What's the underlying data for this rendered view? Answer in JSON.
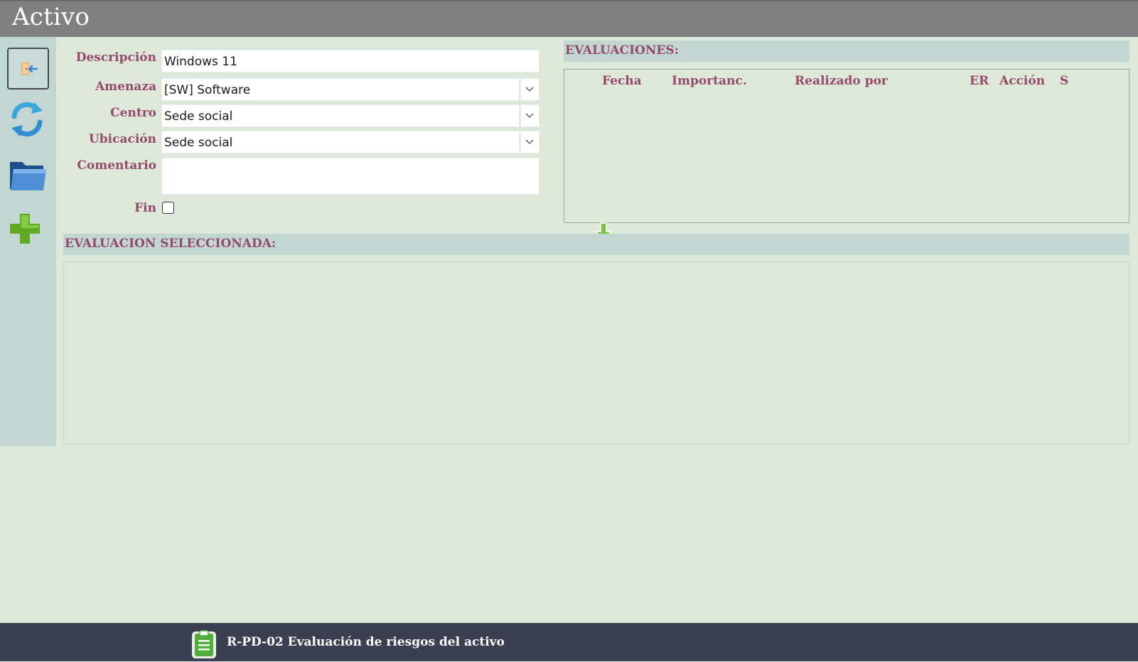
{
  "window": {
    "title": "Activo"
  },
  "sidebar": {
    "items": [
      {
        "name": "exit",
        "icon": "exit-door-icon"
      },
      {
        "name": "refresh",
        "icon": "refresh-icon"
      },
      {
        "name": "folder",
        "icon": "folder-icon"
      },
      {
        "name": "add",
        "icon": "plus-icon"
      }
    ]
  },
  "form": {
    "descripcion_label": "Descripción",
    "descripcion_value": "Windows 11",
    "amenaza_label": "Amenaza",
    "amenaza_value": "[SW] Software",
    "centro_label": "Centro",
    "centro_value": "Sede social",
    "ubicacion_label": "Ubicación",
    "ubicacion_value": "Sede social",
    "comentario_label": "Comentario",
    "comentario_value": "",
    "fin_label": "Fin",
    "fin_checked": false
  },
  "evaluaciones": {
    "title": "EVALUACIONES:",
    "columns": [
      "Fecha",
      "Importanc.",
      "Realizado por",
      "ER",
      "Acción",
      "S"
    ],
    "rows": []
  },
  "selected": {
    "title": "EVALUACION SELECCIONADA:"
  },
  "statusbar": {
    "report": "R-PD-02 Evaluación de riesgos del activo",
    "icon": "clipboard-icon"
  },
  "colors": {
    "label": "#944a69",
    "background": "#dde8da",
    "sidebar": "#c3d7d2",
    "titlebar": "#808080",
    "statusbar": "#3c3f52"
  }
}
